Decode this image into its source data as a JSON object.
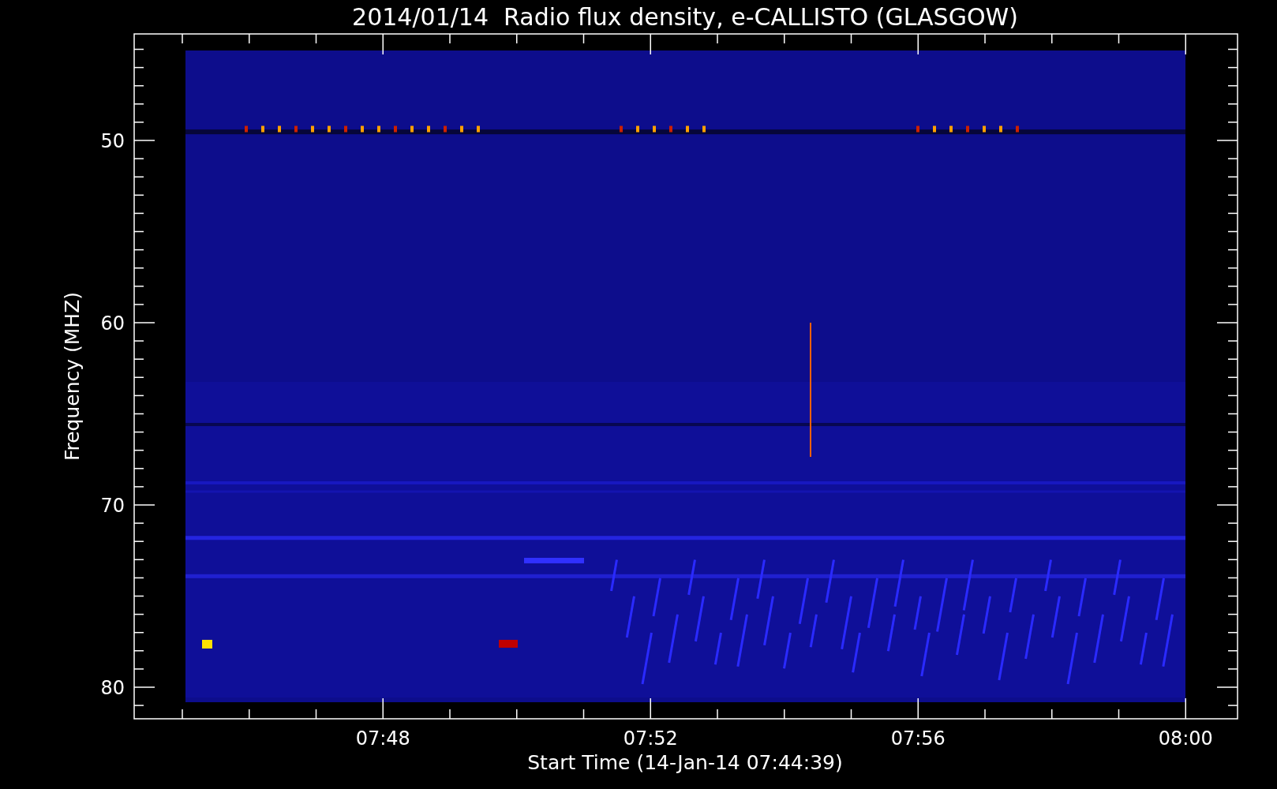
{
  "title": "2014/01/14  Radio flux density, e-CALLISTO (GLASGOW)",
  "y_axis": {
    "label": "Frequency (MHZ)",
    "ticks": [
      "50",
      "60",
      "70",
      "80"
    ]
  },
  "x_axis": {
    "label": "Start Time (14-Jan-14 07:44:39)",
    "ticks": [
      "07:48",
      "07:52",
      "07:56",
      "08:00"
    ]
  }
}
